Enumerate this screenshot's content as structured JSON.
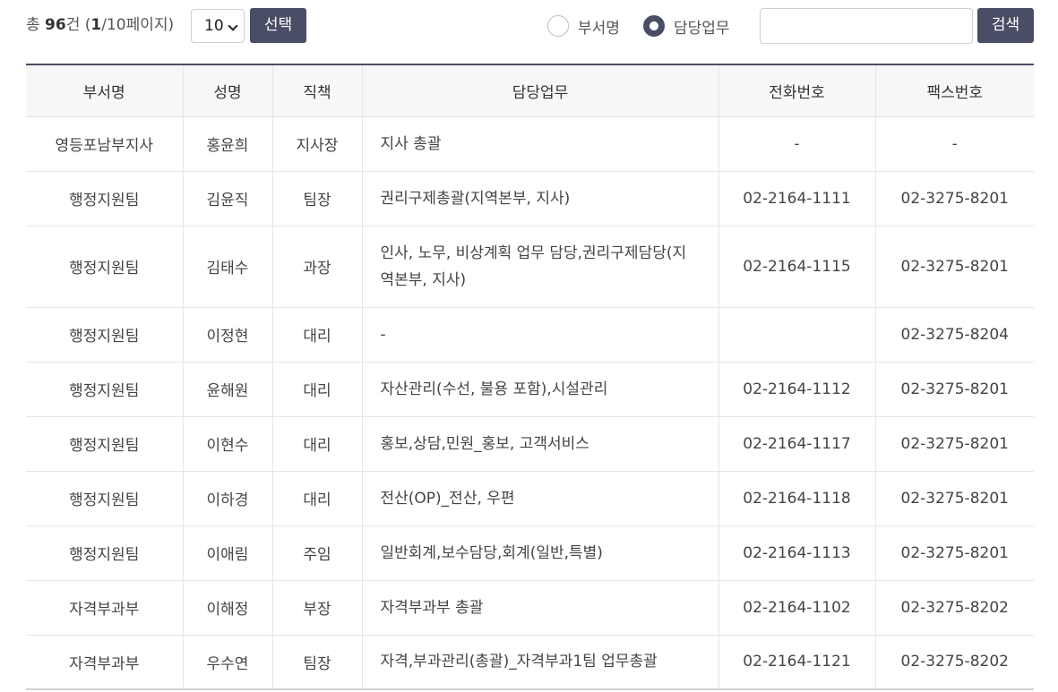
{
  "toolbar": {
    "total_prefix": "총 ",
    "total_count": "96",
    "total_unit": "건 (",
    "current_page": "1",
    "total_pages": "/10페이지)",
    "page_size": "10",
    "select_button": "선택",
    "radio_department": "부서명",
    "radio_task": "담당업무",
    "selected_radio": "담당업무",
    "search_value": "",
    "search_button": "검색"
  },
  "table": {
    "headers": [
      "부서명",
      "성명",
      "직책",
      "담당업무",
      "전화번호",
      "팩스번호"
    ],
    "rows": [
      [
        "영등포남부지사",
        "홍윤희",
        "지사장",
        "지사 총괄",
        "-",
        "-"
      ],
      [
        "행정지원팀",
        "김윤직",
        "팀장",
        "권리구제총괄(지역본부, 지사)",
        "02-2164-1111",
        "02-3275-8201"
      ],
      [
        "행정지원팀",
        "김태수",
        "과장",
        "인사, 노무, 비상계획 업무 담당,권리구제담당(지역본부, 지사)",
        "02-2164-1115",
        "02-3275-8201"
      ],
      [
        "행정지원팀",
        "이정현",
        "대리",
        "-",
        "",
        "02-3275-8204"
      ],
      [
        "행정지원팀",
        "윤해원",
        "대리",
        "자산관리(수선, 불용 포함),시설관리",
        "02-2164-1112",
        "02-3275-8201"
      ],
      [
        "행정지원팀",
        "이현수",
        "대리",
        "홍보,상담,민원_홍보, 고객서비스",
        "02-2164-1117",
        "02-3275-8201"
      ],
      [
        "행정지원팀",
        "이하경",
        "대리",
        "전산(OP)_전산, 우편",
        "02-2164-1118",
        "02-3275-8201"
      ],
      [
        "행정지원팀",
        "이애림",
        "주임",
        "일반회계,보수담당,회계(일반,특별)",
        "02-2164-1113",
        "02-3275-8201"
      ],
      [
        "자격부과부",
        "이해정",
        "부장",
        "자격부과부 총괄",
        "02-2164-1102",
        "02-3275-8202"
      ],
      [
        "자격부과부",
        "우수연",
        "팀장",
        "자격,부과관리(총괄)_자격부과1팀 업무총괄",
        "02-2164-1121",
        "02-3275-8202"
      ]
    ]
  },
  "colors": {
    "accent": "#4a4d66",
    "header_bg": "#f7f7f7",
    "border": "#e6e6e6"
  }
}
